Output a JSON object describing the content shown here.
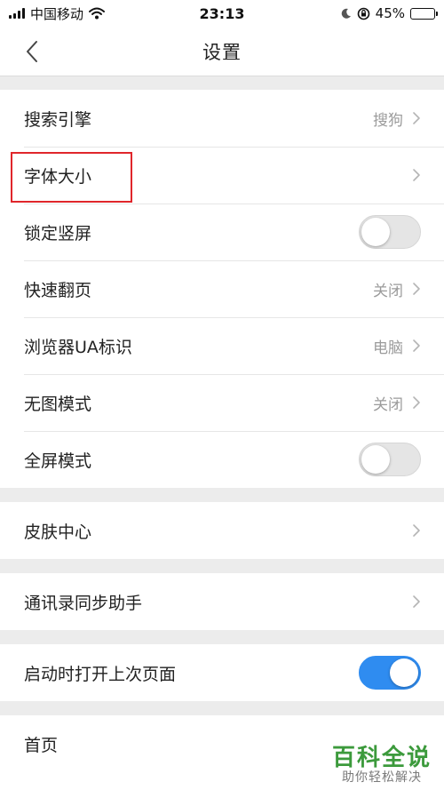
{
  "status_bar": {
    "carrier": "中国移动",
    "time": "23:13",
    "battery_percent": "45%",
    "battery_level": 0.45
  },
  "nav": {
    "title": "设置"
  },
  "groups": [
    {
      "rows": [
        {
          "label": "搜索引擎",
          "value": "搜狗",
          "control": "chevron"
        },
        {
          "label": "字体大小",
          "value": "",
          "control": "chevron"
        },
        {
          "label": "锁定竖屏",
          "control": "toggle",
          "on": false
        },
        {
          "label": "快速翻页",
          "value": "关闭",
          "control": "chevron"
        },
        {
          "label": "浏览器UA标识",
          "value": "电脑",
          "control": "chevron"
        },
        {
          "label": "无图模式",
          "value": "关闭",
          "control": "chevron"
        },
        {
          "label": "全屏模式",
          "control": "toggle",
          "on": false
        }
      ]
    },
    {
      "rows": [
        {
          "label": "皮肤中心",
          "control": "chevron"
        }
      ]
    },
    {
      "rows": [
        {
          "label": "通讯录同步助手",
          "control": "chevron"
        }
      ]
    },
    {
      "rows": [
        {
          "label": "启动时打开上次页面",
          "control": "toggle",
          "on": true
        }
      ]
    },
    {
      "rows": [
        {
          "label": "首页",
          "control": "none"
        }
      ]
    }
  ],
  "watermark": {
    "title": "百科全说",
    "subtitle": "助你轻松解决"
  },
  "colors": {
    "toggle_on": "#2f8cf0",
    "highlight_box": "#e0262b",
    "watermark": "#3c9a3c"
  },
  "icons": {
    "back": "chevron-left-icon",
    "row_arrow": "chevron-right-icon",
    "wifi": "wifi-icon",
    "moon": "moon-icon",
    "orientation_lock": "orientation-lock-icon"
  }
}
